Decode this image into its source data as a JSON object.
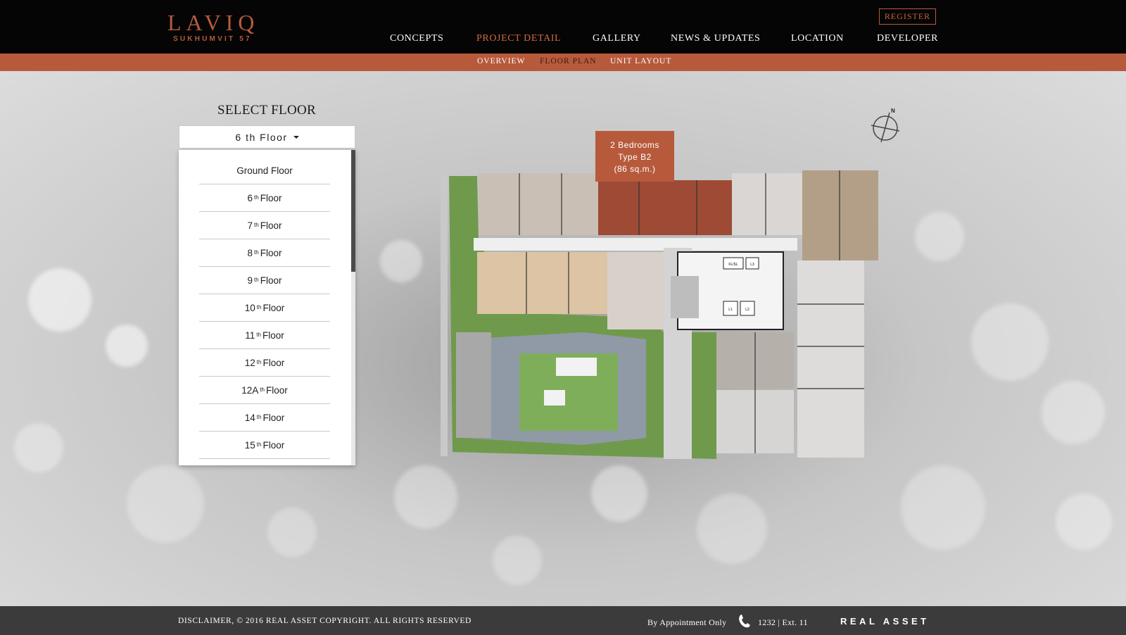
{
  "logo": {
    "main": "LAVIQ",
    "sub": "SUKHUMVIT 57"
  },
  "header": {
    "register_label": "REGISTER",
    "nav": [
      {
        "label": "CONCEPTS",
        "active": false
      },
      {
        "label": "PROJECT DETAIL",
        "active": true
      },
      {
        "label": "GALLERY",
        "active": false
      },
      {
        "label": "NEWS & UPDATES",
        "active": false
      },
      {
        "label": "LOCATION",
        "active": false
      },
      {
        "label": "DEVELOPER",
        "active": false
      }
    ],
    "subnav": [
      {
        "label": "OVERVIEW",
        "active": false
      },
      {
        "label": "FLOOR PLAN",
        "active": true
      },
      {
        "label": "UNIT LAYOUT",
        "active": false
      }
    ]
  },
  "floor_selector": {
    "title": "SELECT FLOOR",
    "selected": "6 th Floor",
    "options": [
      {
        "prefix": "Ground Floor",
        "sup": "",
        "suffix": ""
      },
      {
        "prefix": "6",
        "sup": "th",
        "suffix": "Floor"
      },
      {
        "prefix": "7",
        "sup": "th",
        "suffix": "Floor"
      },
      {
        "prefix": "8",
        "sup": "th",
        "suffix": "Floor"
      },
      {
        "prefix": "9",
        "sup": "th",
        "suffix": "Floor"
      },
      {
        "prefix": "10",
        "sup": "th",
        "suffix": "Floor"
      },
      {
        "prefix": "11",
        "sup": "th",
        "suffix": "Floor"
      },
      {
        "prefix": "12",
        "sup": "th",
        "suffix": "Floor"
      },
      {
        "prefix": "12A",
        "sup": "th",
        "suffix": "Floor"
      },
      {
        "prefix": "14",
        "sup": "th",
        "suffix": "Floor"
      },
      {
        "prefix": "15",
        "sup": "th",
        "suffix": "Floor"
      }
    ]
  },
  "unit_tooltip": {
    "line1": "2 Bedrooms",
    "line2": "Type B2",
    "line3": "(86 sq.m.)"
  },
  "floor_plan": {
    "room_labels": [
      "FL/SL",
      "L3",
      "L1",
      "L2"
    ],
    "compass_label": "N",
    "colors": {
      "highlight": "#9e4a35",
      "accent": "#b75a3c",
      "garden": "#7fae5a",
      "pool": "#8f9aa6"
    }
  },
  "footer": {
    "disclaimer": "DISCLAIMER, © 2016 REAL ASSET COPYRIGHT. ALL RIGHTS RESERVED",
    "appointment": "By Appointment Only",
    "phone": "1232 | Ext. 11",
    "brand": "REAL ASSET"
  },
  "icons": [
    "compass-icon",
    "phone-icon",
    "caret-down-icon"
  ]
}
